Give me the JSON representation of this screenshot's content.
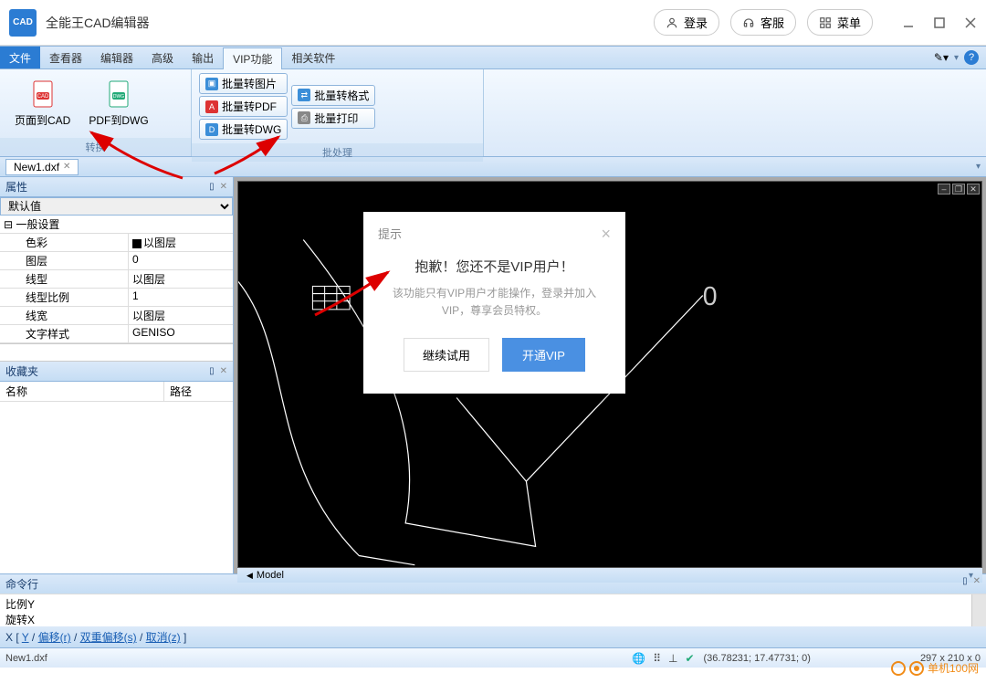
{
  "app": {
    "icon_text": "CAD",
    "title": "全能王CAD编辑器"
  },
  "titlebar_actions": {
    "login": "登录",
    "support": "客服",
    "menu": "菜单"
  },
  "menubar": {
    "file": "文件",
    "tabs": [
      "查看器",
      "编辑器",
      "高级",
      "输出",
      "VIP功能",
      "相关软件"
    ],
    "active_index": 4
  },
  "ribbon": {
    "group1": {
      "label": "转换",
      "btn1": "页面到CAD",
      "btn2": "PDF到DWG"
    },
    "group2": {
      "label": "批处理",
      "items": [
        "批量转图片",
        "批量转PDF",
        "批量转DWG",
        "批量转格式",
        "批量打印"
      ]
    }
  },
  "doc_tab": "New1.dxf",
  "panels": {
    "properties_title": "属性",
    "default_value": "默认值",
    "section": "一般设置",
    "rows": [
      {
        "k": "色彩",
        "v": "以图层",
        "swatch": true
      },
      {
        "k": "图层",
        "v": "0"
      },
      {
        "k": "线型",
        "v": "以图层"
      },
      {
        "k": "线型比例",
        "v": "1"
      },
      {
        "k": "线宽",
        "v": "以图层"
      },
      {
        "k": "文字样式",
        "v": "GENISO"
      }
    ],
    "favorites_title": "收藏夹",
    "fav_cols": [
      "名称",
      "路径"
    ]
  },
  "canvas": {
    "model": "Model",
    "overlay_zero": "0"
  },
  "cmd": {
    "title": "命令行",
    "lines": [
      "比例Y",
      "旋转X"
    ],
    "hint_prefix": "X [ ",
    "hint_links": [
      "Y",
      "偏移(r)",
      "双重偏移(s)",
      "取消(z)"
    ],
    "hint_suffix": " ]"
  },
  "status": {
    "file": "New1.dxf",
    "coords": "(36.78231; 17.47731; 0)",
    "dims": "297 x 210 x 0"
  },
  "modal": {
    "head": "提示",
    "title": "抱歉！您还不是VIP用户！",
    "desc": "该功能只有VIP用户才能操作，登录并加入VIP，尊享会员特权。",
    "btn_secondary": "继续试用",
    "btn_primary": "开通VIP"
  },
  "watermark": "单机100网"
}
